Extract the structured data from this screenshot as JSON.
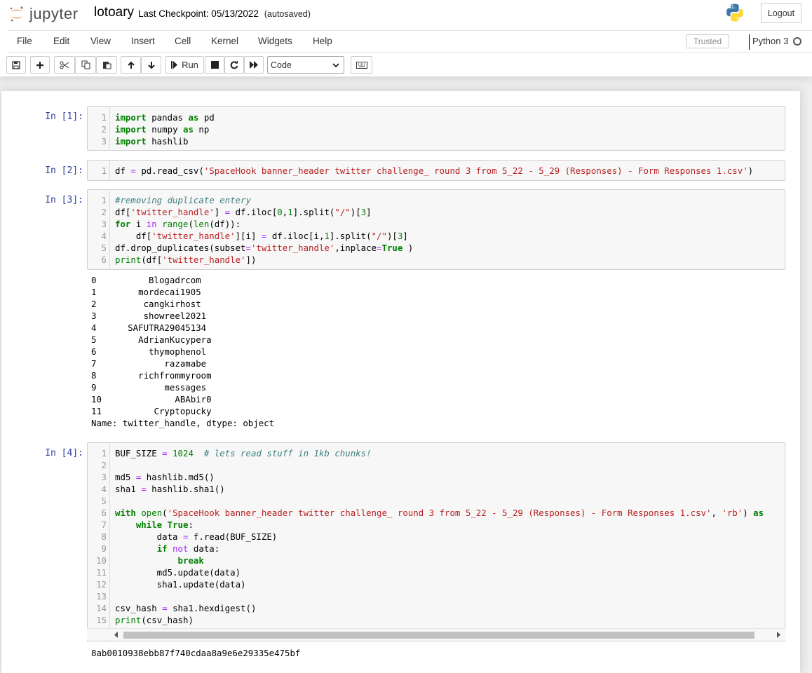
{
  "header": {
    "logo_text": "jupyter",
    "notebook_name": "lotoary",
    "checkpoint": "Last Checkpoint: 05/13/2022",
    "autosave_status": "(autosaved)",
    "logout_label": "Logout"
  },
  "menubar": {
    "items": [
      "File",
      "Edit",
      "View",
      "Insert",
      "Cell",
      "Kernel",
      "Widgets",
      "Help"
    ],
    "trusted_label": "Trusted",
    "kernel_name": "Python 3"
  },
  "toolbar": {
    "run_label": "Run",
    "cell_type": "Code"
  },
  "cells": [
    {
      "prompt": "In [1]:",
      "lines": [
        "import pandas as pd",
        "import numpy as np",
        "import hashlib"
      ]
    },
    {
      "prompt": "In [2]:",
      "lines": [
        "df = pd.read_csv('SpaceHook banner_header twitter challenge_ round 3 from 5_22 - 5_29 (Responses) - Form Responses 1.csv')"
      ]
    },
    {
      "prompt": "In [3]:",
      "lines": [
        "#removing duplicate entery",
        "df['twitter_handle'] = df.iloc[0,1].split(\"/\")[3]",
        "for i in range(len(df)):",
        "    df['twitter_handle'][i] = df.iloc[i,1].split(\"/\")[3]",
        "df.drop_duplicates(subset='twitter_handle',inplace=True )",
        "print(df['twitter_handle'])"
      ],
      "output": [
        "0          Blogadrcom",
        "1        mordecai1905",
        "2         cangkirhost",
        "3         showreel2021",
        "4      SAFUTRA29045134",
        "5        AdrianKucypera",
        "6          thymophenol",
        "7             razamabe",
        "8        richfrommyroom",
        "9             messages",
        "10              ABAbir0",
        "11          Cryptopucky",
        "Name: twitter_handle, dtype: object"
      ]
    },
    {
      "prompt": "In [4]:",
      "lines": [
        "BUF_SIZE = 1024  # lets read stuff in 1kb chunks!",
        "",
        "md5 = hashlib.md5()",
        "sha1 = hashlib.sha1()",
        "",
        "with open('SpaceHook banner_header twitter challenge_ round 3 from 5_22 - 5_29 (Responses) - Form Responses 1.csv', 'rb') as",
        "    while True:",
        "        data = f.read(BUF_SIZE)",
        "        if not data:",
        "            break",
        "        md5.update(data)",
        "        sha1.update(data)",
        "",
        "csv_hash = sha1.hexdigest()",
        "print(csv_hash)"
      ],
      "output": [
        "8ab0010938ebb87f740cdaa8a9e6e29335e475bf"
      ]
    }
  ],
  "icons": [
    "save-icon",
    "plus-icon",
    "cut-icon",
    "copy-icon",
    "paste-icon",
    "arrow-up-icon",
    "arrow-down-icon",
    "step-forward-icon",
    "stop-icon",
    "restart-icon",
    "fast-forward-icon",
    "keyboard-icon",
    "python-logo-icon",
    "kernel-idle-icon"
  ],
  "colors": {
    "prompt": "#303f9f",
    "keyword": "#008000",
    "string": "#ba2121",
    "comment": "#408080",
    "operator": "#aa22ff",
    "logo_orange": "#f37726"
  }
}
